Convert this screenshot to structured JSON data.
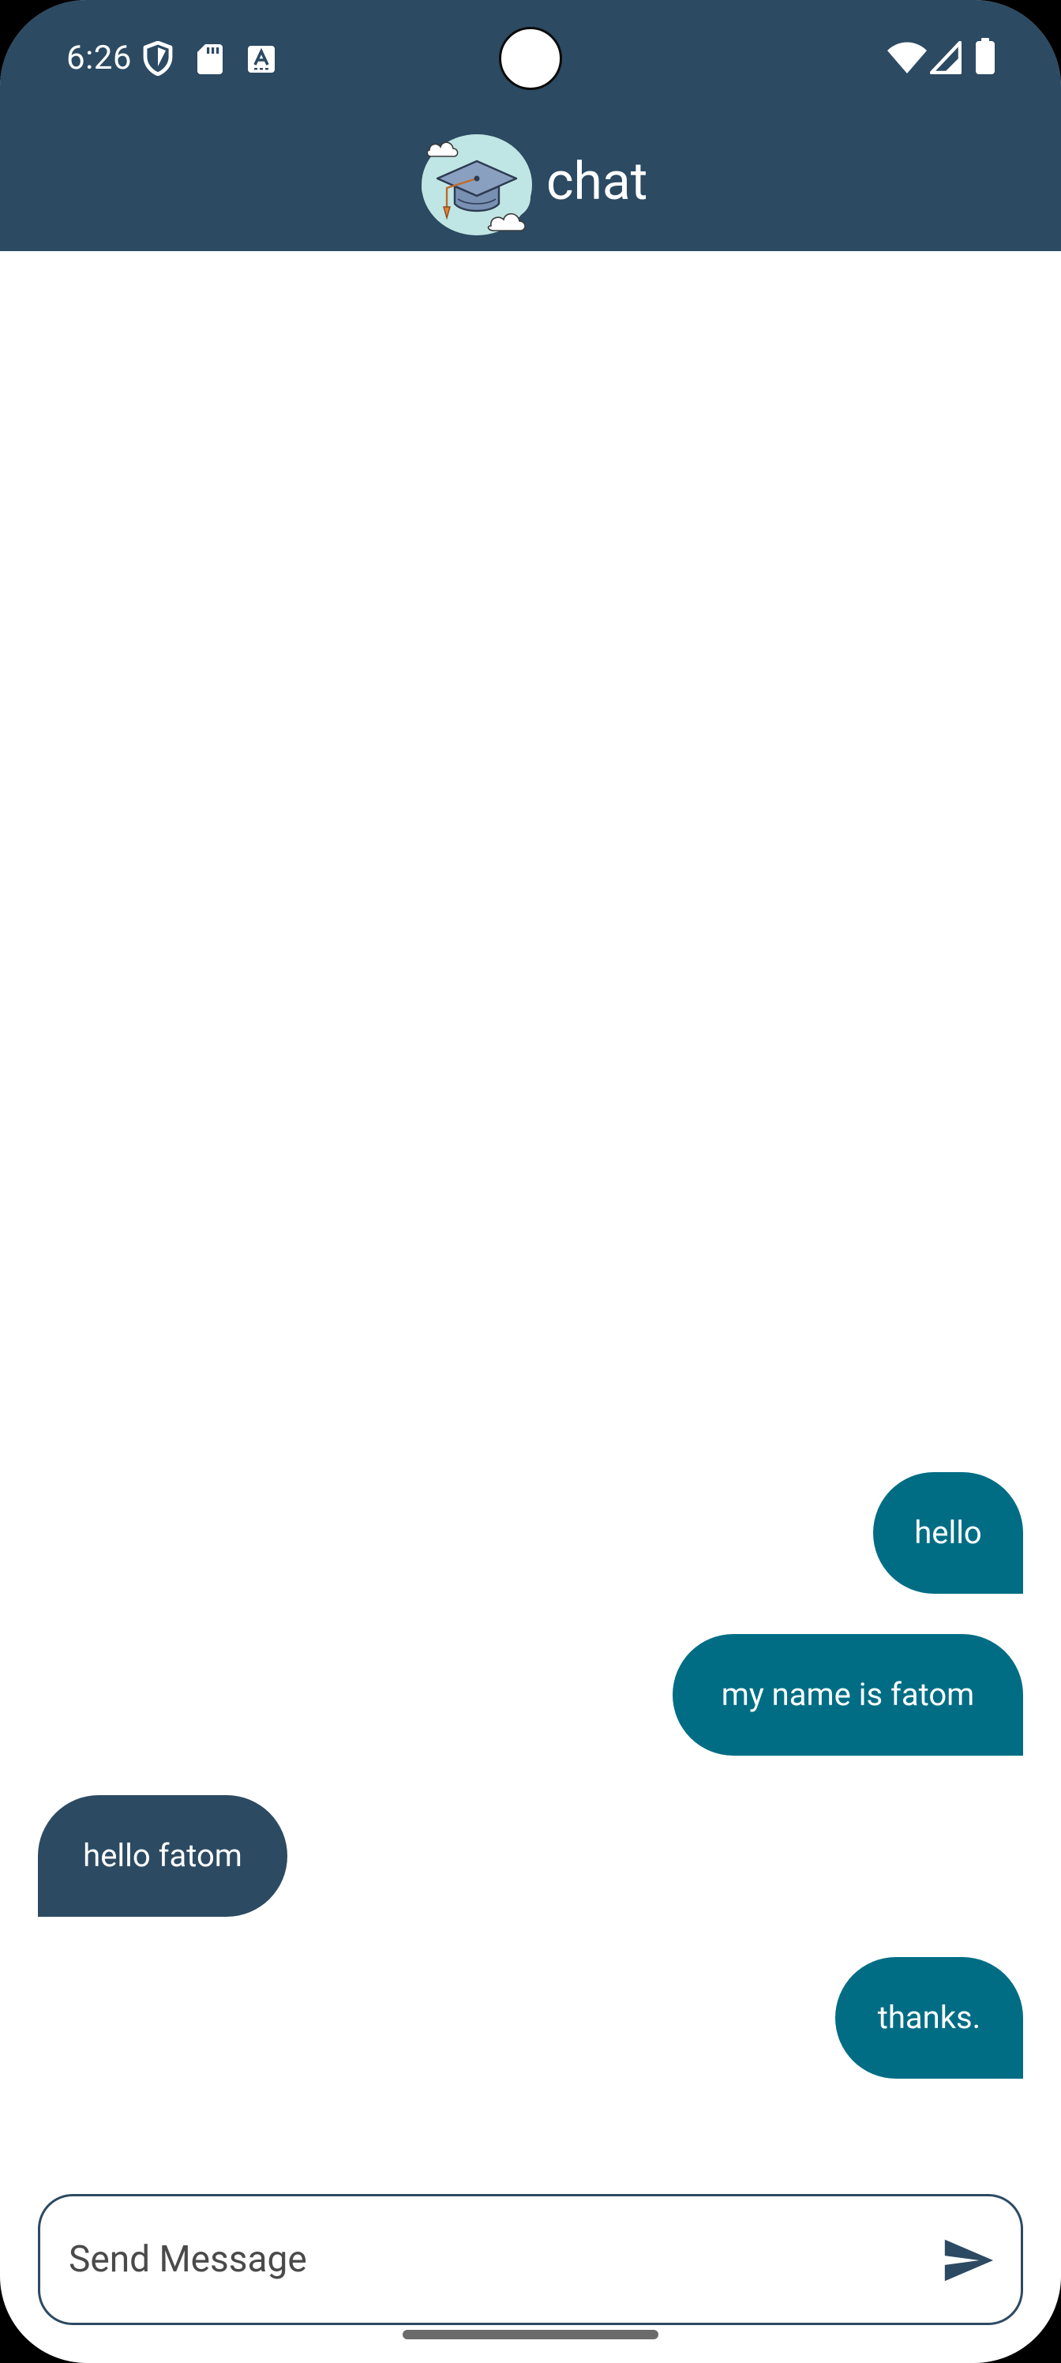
{
  "status_bar": {
    "time": "6:26",
    "icons": [
      "shield-icon",
      "sd-card-icon",
      "keyboard-a-icon",
      "wifi-icon",
      "signal-icon",
      "battery-icon"
    ]
  },
  "app_bar": {
    "title": "chat",
    "logo": "graduation-cap-logo",
    "background": "#2c4a62"
  },
  "messages": [
    {
      "text": "hello",
      "direction": "sent"
    },
    {
      "text": "my name is fatom",
      "direction": "sent"
    },
    {
      "text": "hello fatom",
      "direction": "received"
    },
    {
      "text": "thanks.",
      "direction": "sent"
    }
  ],
  "composer": {
    "placeholder": "Send Message",
    "value": "",
    "send_icon": "send-icon"
  },
  "colors": {
    "sent_bubble": "#006d85",
    "received_bubble": "#2c4a62",
    "accent": "#2c4a62"
  }
}
